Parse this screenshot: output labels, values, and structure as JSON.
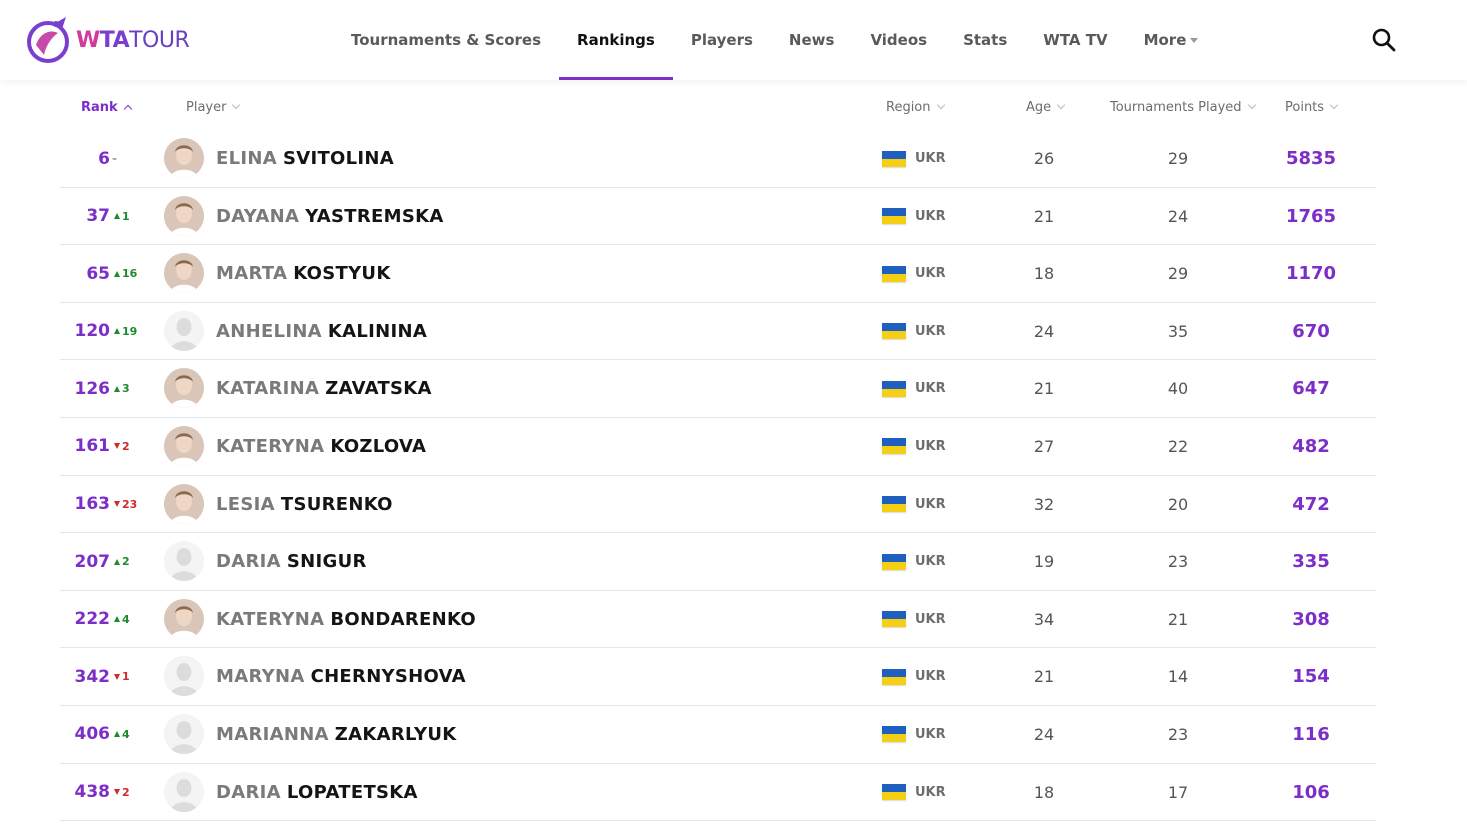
{
  "header": {
    "logo_w": "W",
    "logo_ta": "TA",
    "logo_tour": "TOUR",
    "nav": [
      {
        "label": "Tournaments & Scores"
      },
      {
        "label": "Rankings"
      },
      {
        "label": "Players"
      },
      {
        "label": "News"
      },
      {
        "label": "Videos"
      },
      {
        "label": "Stats"
      },
      {
        "label": "WTA TV"
      },
      {
        "label": "More"
      }
    ],
    "active_nav": "Rankings"
  },
  "colors": {
    "accent": "#7d2ec8",
    "up": "#1e8a2e",
    "down": "#d12a2a",
    "flag_blue": "#1f5fbf",
    "flag_yellow": "#f5cf14"
  },
  "table": {
    "columns": {
      "rank": "Rank",
      "player": "Player",
      "region": "Region",
      "age": "Age",
      "tournaments": "Tournaments Played",
      "points": "Points"
    },
    "sorted_by": "Rank",
    "rows": [
      {
        "rank": "6",
        "move": "-",
        "dir": "none",
        "first": "ELINA",
        "last": "SVITOLINA",
        "region": "UKR",
        "age": "26",
        "tp": "29",
        "points": "5835",
        "photo": "photo"
      },
      {
        "rank": "37",
        "move": "1",
        "dir": "up",
        "first": "DAYANA",
        "last": "YASTREMSKA",
        "region": "UKR",
        "age": "21",
        "tp": "24",
        "points": "1765",
        "photo": "photo"
      },
      {
        "rank": "65",
        "move": "16",
        "dir": "up",
        "first": "MARTA",
        "last": "KOSTYUK",
        "region": "UKR",
        "age": "18",
        "tp": "29",
        "points": "1170",
        "photo": "photo"
      },
      {
        "rank": "120",
        "move": "19",
        "dir": "up",
        "first": "ANHELINA",
        "last": "KALININA",
        "region": "UKR",
        "age": "24",
        "tp": "35",
        "points": "670",
        "photo": "placeholder"
      },
      {
        "rank": "126",
        "move": "3",
        "dir": "up",
        "first": "KATARINA",
        "last": "ZAVATSKA",
        "region": "UKR",
        "age": "21",
        "tp": "40",
        "points": "647",
        "photo": "photo"
      },
      {
        "rank": "161",
        "move": "2",
        "dir": "down",
        "first": "KATERYNA",
        "last": "KOZLOVA",
        "region": "UKR",
        "age": "27",
        "tp": "22",
        "points": "482",
        "photo": "photo"
      },
      {
        "rank": "163",
        "move": "23",
        "dir": "down",
        "first": "LESIA",
        "last": "TSURENKO",
        "region": "UKR",
        "age": "32",
        "tp": "20",
        "points": "472",
        "photo": "photo"
      },
      {
        "rank": "207",
        "move": "2",
        "dir": "up",
        "first": "DARIA",
        "last": "SNIGUR",
        "region": "UKR",
        "age": "19",
        "tp": "23",
        "points": "335",
        "photo": "placeholder"
      },
      {
        "rank": "222",
        "move": "4",
        "dir": "up",
        "first": "KATERYNA",
        "last": "BONDARENKO",
        "region": "UKR",
        "age": "34",
        "tp": "21",
        "points": "308",
        "photo": "photo"
      },
      {
        "rank": "342",
        "move": "1",
        "dir": "down",
        "first": "MARYNA",
        "last": "CHERNYSHOVA",
        "region": "UKR",
        "age": "21",
        "tp": "14",
        "points": "154",
        "photo": "placeholder"
      },
      {
        "rank": "406",
        "move": "4",
        "dir": "up",
        "first": "MARIANNA",
        "last": "ZAKARLYUK",
        "region": "UKR",
        "age": "24",
        "tp": "23",
        "points": "116",
        "photo": "placeholder"
      },
      {
        "rank": "438",
        "move": "2",
        "dir": "down",
        "first": "DARIA",
        "last": "LOPATETSKA",
        "region": "UKR",
        "age": "18",
        "tp": "17",
        "points": "106",
        "photo": "placeholder"
      }
    ]
  }
}
